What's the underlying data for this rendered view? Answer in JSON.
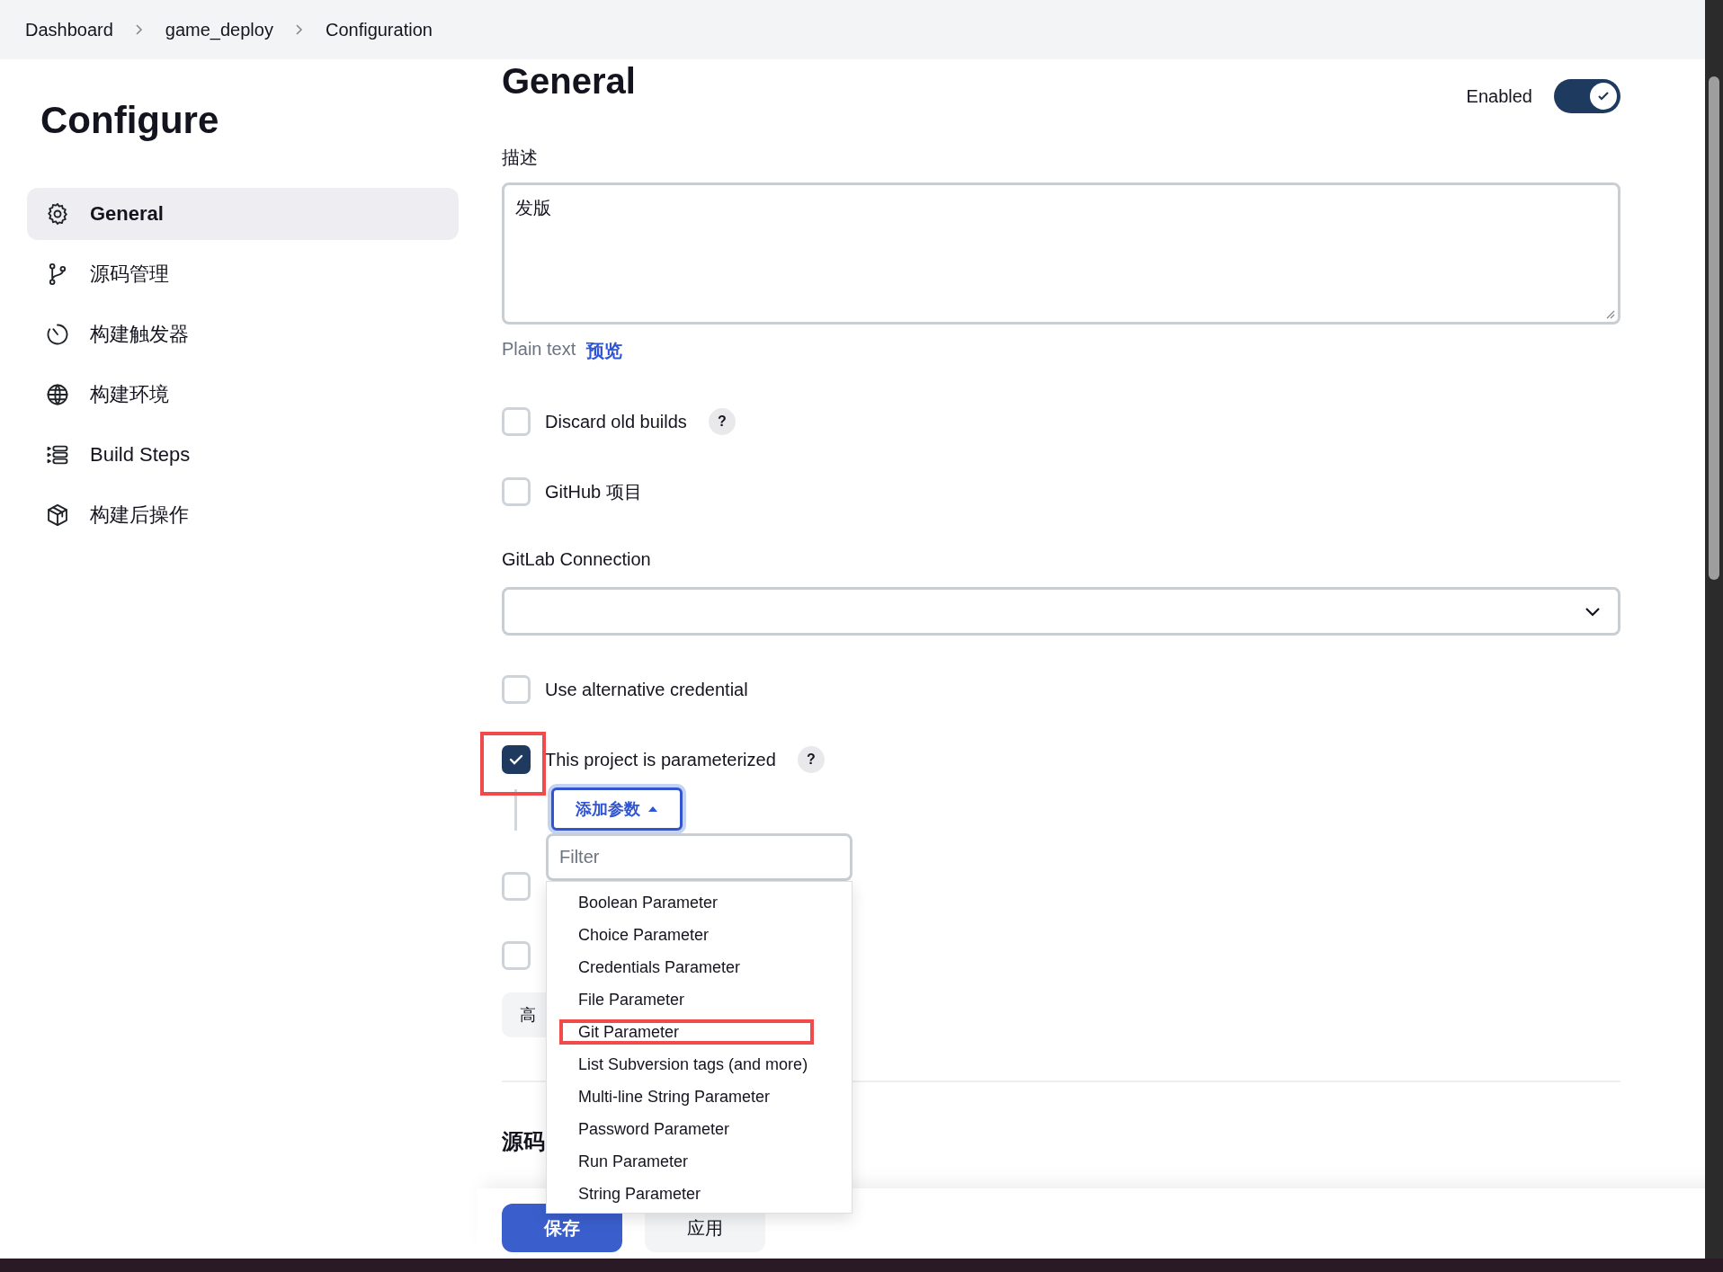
{
  "breadcrumbs": [
    "Dashboard",
    "game_deploy",
    "Configuration"
  ],
  "sidebar": {
    "title": "Configure",
    "items": [
      {
        "label": "General",
        "selected": true
      },
      {
        "label": "源码管理",
        "selected": false
      },
      {
        "label": "构建触发器",
        "selected": false
      },
      {
        "label": "构建环境",
        "selected": false
      },
      {
        "label": "Build Steps",
        "selected": false
      },
      {
        "label": "构建后操作",
        "selected": false
      }
    ]
  },
  "section": {
    "title": "General",
    "enabled_label": "Enabled",
    "enabled": true
  },
  "description": {
    "label": "描述",
    "value": "发版",
    "format_note": "Plain text",
    "preview_link": "预览"
  },
  "options": [
    {
      "label": "Discard old builds",
      "checked": false,
      "help": "?"
    },
    {
      "label": "GitHub 项目",
      "checked": false
    }
  ],
  "gitlab_connection": {
    "label": "GitLab Connection"
  },
  "alt_credential": {
    "label": "Use alternative credential",
    "checked": false
  },
  "parameterized": {
    "label": "This project is parameterized",
    "checked": true,
    "help": "?",
    "highlighted": true
  },
  "add_parameter": {
    "label": "添加参数",
    "expanded": true,
    "filter_placeholder": "Filter",
    "items": [
      {
        "label": "Boolean Parameter",
        "highlighted": false
      },
      {
        "label": "Choice Parameter",
        "highlighted": false
      },
      {
        "label": "Credentials Parameter",
        "highlighted": false
      },
      {
        "label": "File Parameter",
        "highlighted": false
      },
      {
        "label": "Git Parameter",
        "highlighted": true
      },
      {
        "label": "List Subversion tags (and more)",
        "highlighted": false
      },
      {
        "label": "Multi-line String Parameter",
        "highlighted": false
      },
      {
        "label": "Password Parameter",
        "highlighted": false
      },
      {
        "label": "Run Parameter",
        "highlighted": false
      },
      {
        "label": "String Parameter",
        "highlighted": false
      }
    ]
  },
  "covered_options": [
    {
      "checked": false
    },
    {
      "checked": false
    }
  ],
  "advanced_button": "高",
  "next_section": {
    "title": "源码"
  },
  "buttons": [
    {
      "label": "保存",
      "kind": "primary"
    },
    {
      "label": "应用",
      "kind": "secondary"
    }
  ]
}
